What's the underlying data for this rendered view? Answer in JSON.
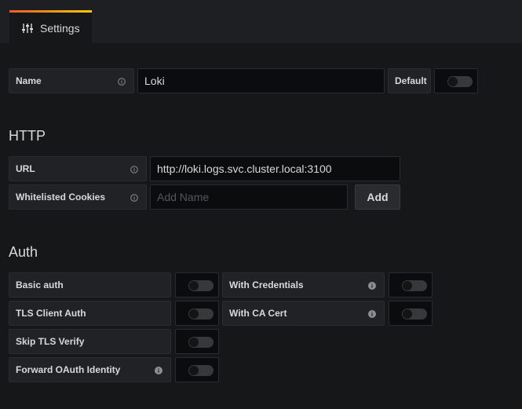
{
  "tab": {
    "label": "Settings",
    "icon": "sliders-icon"
  },
  "general": {
    "name_label": "Name",
    "name_value": "Loki",
    "default_label": "Default",
    "default_enabled": false
  },
  "http": {
    "heading": "HTTP",
    "url_label": "URL",
    "url_value": "http://loki.logs.svc.cluster.local:3100",
    "cookies_label": "Whitelisted Cookies",
    "cookies_placeholder": "Add Name",
    "add_label": "Add"
  },
  "auth": {
    "heading": "Auth",
    "basic_auth_label": "Basic auth",
    "basic_auth_enabled": false,
    "with_credentials_label": "With Credentials",
    "with_credentials_enabled": false,
    "tls_client_auth_label": "TLS Client Auth",
    "tls_client_auth_enabled": false,
    "with_ca_cert_label": "With CA Cert",
    "with_ca_cert_enabled": false,
    "skip_tls_label": "Skip TLS Verify",
    "skip_tls_enabled": false,
    "forward_oauth_label": "Forward OAuth Identity",
    "forward_oauth_enabled": false
  },
  "colors": {
    "background": "#161719",
    "tab_accent_start": "#f05a28",
    "tab_accent_end": "#fbca0a"
  }
}
